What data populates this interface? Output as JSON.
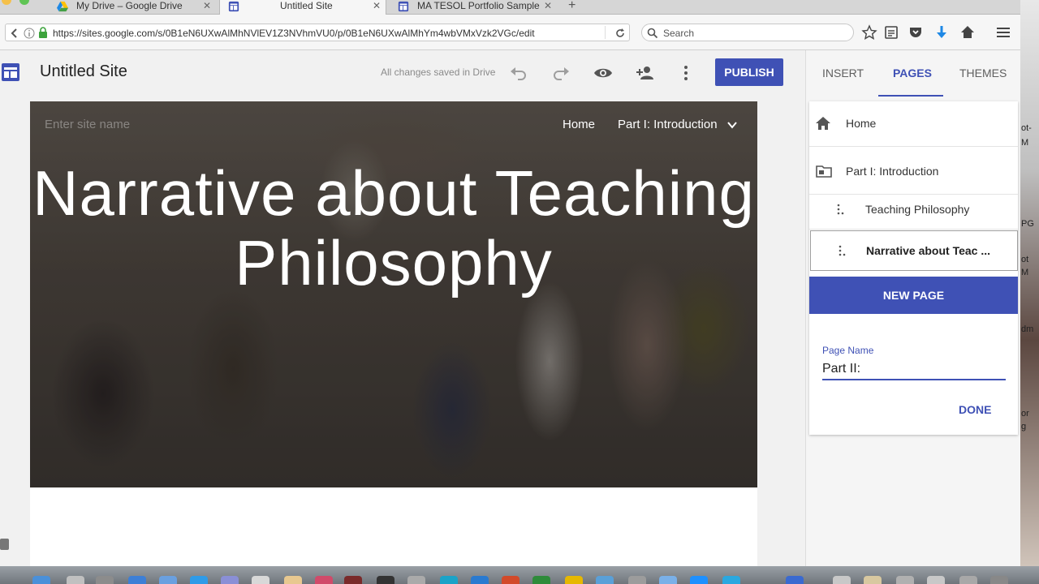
{
  "browser": {
    "tabs": [
      {
        "title": "My Drive – Google Drive",
        "favicon": "google-drive-icon"
      },
      {
        "title": "Untitled Site",
        "favicon": "google-sites-icon",
        "active": true
      },
      {
        "title": "MA TESOL Portfolio Sample",
        "favicon": "google-sites-icon"
      }
    ],
    "url": "https://sites.google.com/s/0B1eN6UXwAlMhNVlEV1Z3NVhmVU0/p/0B1eN6UXwAlMhYm4wbVMxVzk2VGc/edit",
    "search_placeholder": "Search"
  },
  "app": {
    "title": "Untitled Site",
    "save_status": "All changes saved in Drive",
    "publish_label": "PUBLISH",
    "accent_color": "#3f51b5"
  },
  "site": {
    "name_placeholder": "Enter site name",
    "nav": {
      "home": "Home",
      "part1": "Part I: Introduction"
    },
    "hero_title": "Narrative about Teaching Philosophy"
  },
  "panel": {
    "tabs": {
      "insert": "INSERT",
      "pages": "PAGES",
      "themes": "THEMES"
    },
    "pages": {
      "home": "Home",
      "part1": "Part I: Introduction",
      "teaching": "Teaching Philosophy",
      "narrative": "Narrative about Teac ..."
    },
    "new_page_label": "NEW PAGE",
    "page_name_label": "Page Name",
    "page_name_value": "Part II:",
    "done_label": "DONE"
  },
  "desktop": {
    "right_labels": [
      "ot-",
      "M",
      "PG",
      "ot",
      "M",
      "dm",
      "or",
      "g"
    ]
  }
}
